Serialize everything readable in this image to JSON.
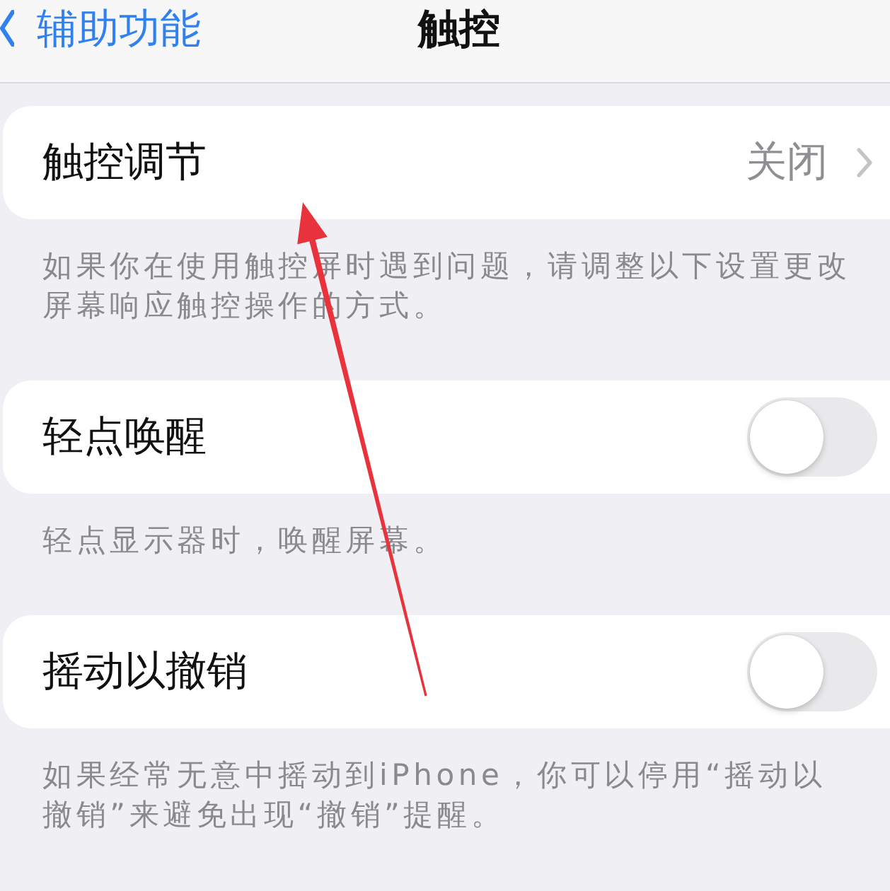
{
  "nav": {
    "back_label": "辅助功能",
    "title": "触控"
  },
  "sections": [
    {
      "kind": "link",
      "label": "触控调节",
      "value": "关闭",
      "footer": "如果你在使用触控屏时遇到问题，请调整以下设置更改屏幕响应触控操作的方式。"
    },
    {
      "kind": "toggle",
      "label": "轻点唤醒",
      "on": false,
      "footer": "轻点显示器时，唤醒屏幕。"
    },
    {
      "kind": "toggle",
      "label": "摇动以撤销",
      "on": false,
      "footer": "如果经常无意中摇动到iPhone，你可以停用“摇动以撤销”来避免出现“撤销”提醒。"
    }
  ]
}
